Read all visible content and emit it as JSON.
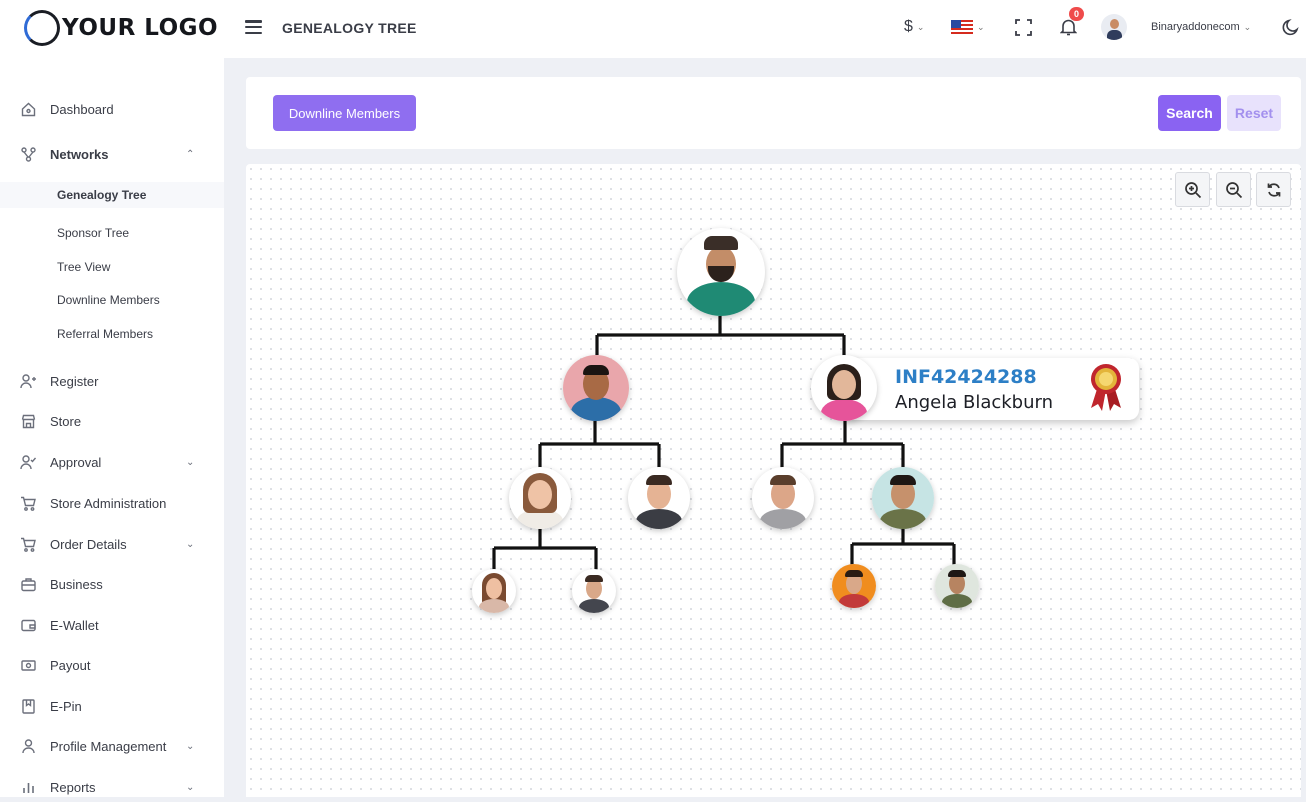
{
  "header": {
    "logo_text": "YOUR LOGO",
    "page_title": "GENEALOGY TREE",
    "currency": "$",
    "notification_count": "0",
    "username": "Binaryaddonecom"
  },
  "sidebar": {
    "items": [
      {
        "label": "Dashboard",
        "icon": "home-icon"
      },
      {
        "label": "Networks",
        "icon": "network-icon"
      },
      {
        "label": "Register",
        "icon": "user-plus-icon"
      },
      {
        "label": "Store",
        "icon": "store-icon"
      },
      {
        "label": "Approval",
        "icon": "user-check-icon"
      },
      {
        "label": "Store Administration",
        "icon": "cart-icon"
      },
      {
        "label": "Order Details",
        "icon": "cart-icon"
      },
      {
        "label": "Business",
        "icon": "briefcase-icon"
      },
      {
        "label": "E-Wallet",
        "icon": "wallet-icon"
      },
      {
        "label": "Payout",
        "icon": "cash-icon"
      },
      {
        "label": "E-Pin",
        "icon": "bookmark-icon"
      },
      {
        "label": "Profile Management",
        "icon": "user-icon"
      },
      {
        "label": "Reports",
        "icon": "bar-chart-icon"
      }
    ],
    "network_sub": [
      {
        "label": "Genealogy Tree",
        "active": true
      },
      {
        "label": "Sponsor Tree"
      },
      {
        "label": "Tree View"
      },
      {
        "label": "Downline Members"
      },
      {
        "label": "Referral Members"
      }
    ]
  },
  "filter": {
    "downline_button": "Downline Members",
    "search_button": "Search",
    "reset_button": "Reset"
  },
  "tree": {
    "hover_card": {
      "member_id": "INF42424288",
      "member_name": "Angela Blackburn"
    }
  },
  "colors": {
    "accent": "#8a63f2",
    "accent_light": "#e8e2fc",
    "id_blue": "#2d7fc6"
  }
}
